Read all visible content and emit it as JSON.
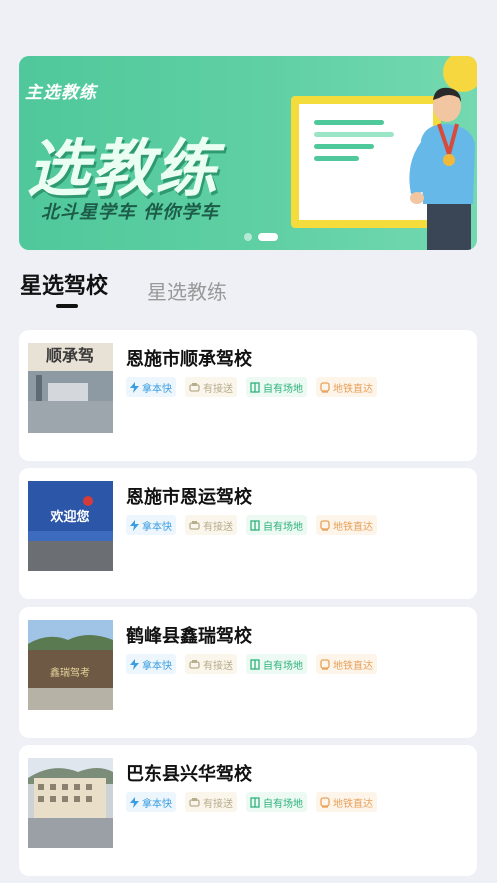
{
  "banner": {
    "subtitle": "主选教练",
    "title": "选教练",
    "slogan": "北斗星学车 伴你学车",
    "active_slide": 2,
    "slide_count": 2
  },
  "tabs": [
    {
      "label": "星选驾校",
      "active": true
    },
    {
      "label": "星选教练",
      "active": false
    }
  ],
  "schools": [
    {
      "name": "恩施市顺承驾校",
      "thumb_sign": "顺承驾",
      "tags": [
        "拿本快",
        "有接送",
        "自有场地",
        "地铁直达"
      ]
    },
    {
      "name": "恩施市恩运驾校",
      "thumb_sign": "欢迎您",
      "tags": [
        "拿本快",
        "有接送",
        "自有场地",
        "地铁直达"
      ]
    },
    {
      "name": "鹤峰县鑫瑞驾校",
      "thumb_sign": "鑫瑞驾考",
      "tags": [
        "拿本快",
        "有接送",
        "自有场地",
        "地铁直达"
      ]
    },
    {
      "name": "巴东县兴华驾校",
      "thumb_sign": "",
      "tags": [
        "拿本快",
        "有接送",
        "自有场地",
        "地铁直达"
      ]
    }
  ],
  "colors": {
    "banner_green": "#4fc89b",
    "tag_fast": "#3a9de0",
    "tag_pickup": "#b7ac8c",
    "tag_field": "#2fb27a",
    "tag_subway": "#e8a15a"
  }
}
